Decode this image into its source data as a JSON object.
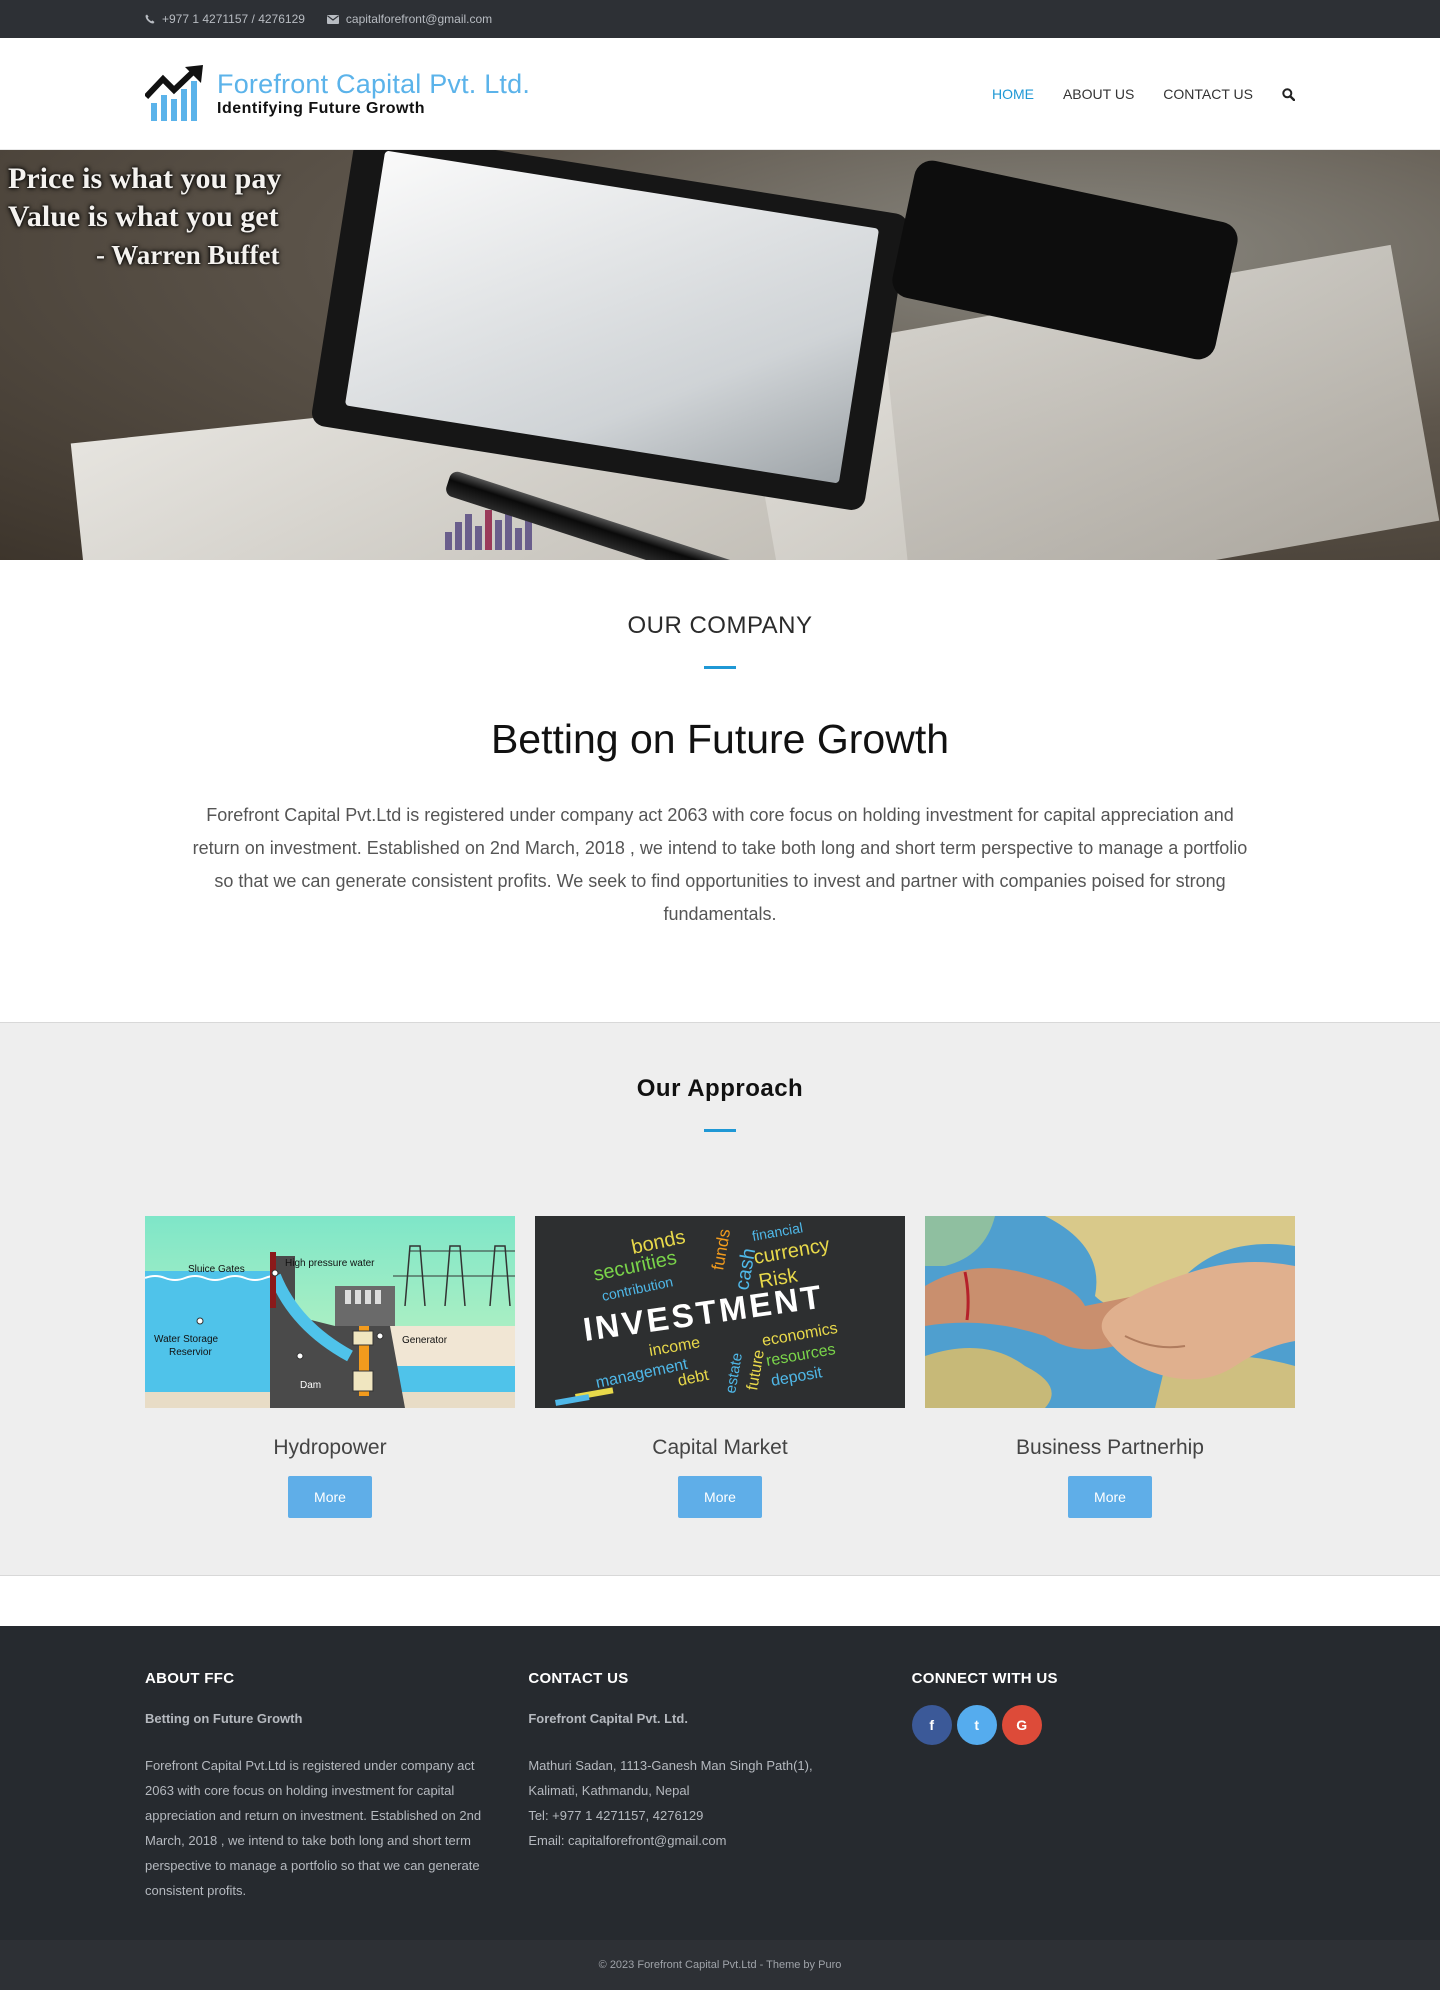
{
  "topbar": {
    "phone": "+977 1 4271157 / 4276129",
    "email": "capitalforefront@gmail.com",
    "icons": [
      "phone-icon",
      "envelope-icon"
    ]
  },
  "header": {
    "logo_title": "Forefront Capital Pvt. Ltd.",
    "logo_tagline": "Identifying Future Growth",
    "nav": [
      {
        "label": "HOME",
        "active": true
      },
      {
        "label": "ABOUT US",
        "active": false
      },
      {
        "label": "CONTACT US",
        "active": false
      }
    ],
    "search_icon": "search-icon",
    "accent_color": "#1f98d5"
  },
  "hero": {
    "quote_lines": [
      "Price is what you pay",
      "Value is what you get",
      "- Warren Buffet"
    ]
  },
  "company": {
    "heading": "OUR COMPANY",
    "headline": "Betting on Future Growth",
    "body": "Forefront Capital Pvt.Ltd is registered under company act 2063 with core focus on holding investment for capital appreciation and return on investment. Established on 2nd March, 2018 , we intend to take both long and short term perspective to manage a portfolio so that we can generate consistent profits. We seek to find opportunities to invest and partner with companies poised for strong fundamentals."
  },
  "approach": {
    "heading": "Our Approach",
    "cards": [
      {
        "title": "Hydropower",
        "button": "More",
        "image_labels": [
          "Sluice Gates",
          "High pressure water",
          "Water Storage",
          "Reservior",
          "Generator",
          "Dam"
        ]
      },
      {
        "title": "Capital Market",
        "button": "More",
        "image_words": [
          "bonds",
          "funds",
          "financial",
          "securities",
          "cash",
          "currency",
          "contribution",
          "Risk",
          "INVESTMENT",
          "income",
          "estate",
          "future",
          "economics",
          "management",
          "resources",
          "debt",
          "deposit"
        ]
      },
      {
        "title": "Business Partnerhip",
        "button": "More"
      }
    ]
  },
  "footer": {
    "about": {
      "heading": "ABOUT FFC",
      "subheading": "Betting on Future Growth",
      "text": "Forefront Capital Pvt.Ltd is registered under company act 2063 with core focus on holding investment for capital appreciation and return on investment. Established on 2nd March, 2018 , we intend to take both long and short term perspective to manage a portfolio so that we can generate consistent profits."
    },
    "contact": {
      "heading": "CONTACT US",
      "company": "Forefront Capital Pvt. Ltd.",
      "address_line1": "Mathuri Sadan, 1113-Ganesh Man Singh Path(1),",
      "address_line2": "Kalimati, Kathmandu, Nepal",
      "tel": "Tel: +977 1 4271157, 4276129",
      "email": "Email: capitalforefront@gmail.com"
    },
    "connect": {
      "heading": "CONNECT WITH US",
      "social": [
        {
          "name": "facebook-icon",
          "glyph": "f",
          "color": "#3b5998"
        },
        {
          "name": "twitter-icon",
          "glyph": "t",
          "color": "#55acee"
        },
        {
          "name": "google-plus-icon",
          "glyph": "G",
          "color": "#dd4b39"
        }
      ]
    },
    "copyright": "© 2023 Forefront Capital Pvt.Ltd  -  Theme by Puro"
  }
}
